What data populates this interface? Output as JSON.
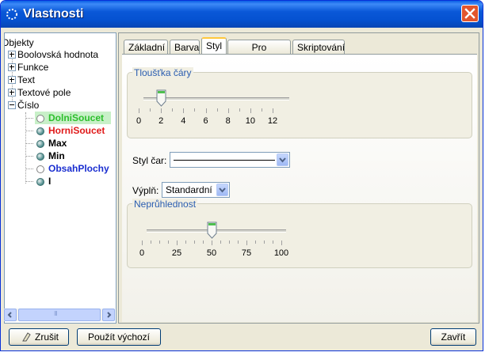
{
  "window": {
    "title": "Vlastnosti",
    "title_icon": "gear-icon",
    "close_icon": "close-icon"
  },
  "tree": {
    "items": [
      {
        "label": "Objekty",
        "color": "#000000"
      },
      {
        "label": "Boolovská hodnota",
        "color": "#000000"
      },
      {
        "label": "Funkce",
        "color": "#000000"
      },
      {
        "label": "Text",
        "color": "#000000"
      },
      {
        "label": "Textové pole",
        "color": "#000000"
      },
      {
        "label": "Číslo",
        "color": "#000000"
      },
      {
        "label": "DolniSoucet",
        "color": "#2cbf2c"
      },
      {
        "label": "HorniSoucet",
        "color": "#e01a1a"
      },
      {
        "label": "Max",
        "color": "#000000"
      },
      {
        "label": "Min",
        "color": "#000000"
      },
      {
        "label": "ObsahPlochy",
        "color": "#1a2ed0"
      },
      {
        "label": "I",
        "color": "#000000"
      }
    ],
    "scroll_thumb_grip": "III"
  },
  "tabs": [
    "Základní",
    "Barva",
    "Styl",
    "Pro pokročilé",
    "Skriptování"
  ],
  "active_tab": "Styl",
  "thickness": {
    "title": "Tloušťka čáry",
    "ticks": [
      "0",
      "2",
      "4",
      "6",
      "8",
      "10",
      "12"
    ],
    "value": 2
  },
  "line_style": {
    "label": "Styl čar:"
  },
  "fill": {
    "label": "Výplň:",
    "selected": "Standardní"
  },
  "opacity": {
    "title": "Neprůhlednost",
    "ticks": [
      "0",
      "25",
      "50",
      "75",
      "100"
    ],
    "value": 50
  },
  "buttons": {
    "cancel": "Zrušit",
    "defaults": "Použít výchozí",
    "close": "Zavřít"
  },
  "colors": {
    "title_bar": "#0a58d8",
    "selection": "#c8f0c8",
    "group_title": "#2a5db0"
  }
}
